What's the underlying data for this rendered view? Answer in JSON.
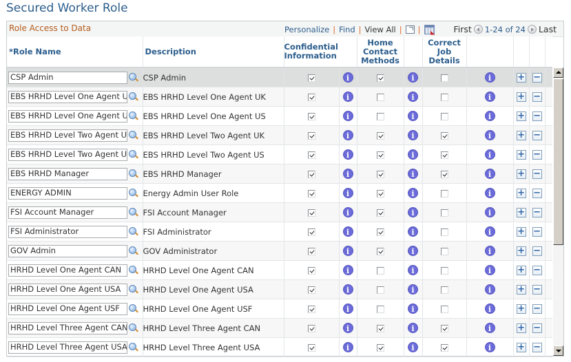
{
  "page": {
    "title": "Secured Worker Role"
  },
  "grid": {
    "title": "Role Access to Data",
    "nav": {
      "personalize": "Personalize",
      "find": "Find",
      "view_all": "View All",
      "separator": "|",
      "zoom_icon": "new-window-icon",
      "download_icon": "download-to-excel-icon",
      "first": "First",
      "range": "1-24 of 24",
      "last": "Last"
    },
    "columns": {
      "role_name": "*Role Name",
      "description": "Description",
      "confidential": "Confidential Information",
      "home_contact": "Home Contact Methods",
      "correct_job": "Correct Job Details"
    },
    "info_glyph": "i",
    "add_glyph": "+",
    "remove_glyph": "−",
    "rows": [
      {
        "role": "CSP Admin",
        "desc": "CSP Admin",
        "confidential": true,
        "home_contact": true,
        "correct_job": false
      },
      {
        "role": "EBS HRHD Level One Agent UK",
        "desc": "EBS HRHD Level One Agent UK",
        "confidential": true,
        "home_contact": false,
        "correct_job": false
      },
      {
        "role": "EBS HRHD Level One Agent US",
        "desc": "EBS HRHD Level One Agent US",
        "confidential": true,
        "home_contact": false,
        "correct_job": false
      },
      {
        "role": "EBS HRHD Level Two Agent UK",
        "desc": "EBS HRHD Level Two Agent UK",
        "confidential": true,
        "home_contact": true,
        "correct_job": true
      },
      {
        "role": "EBS HRHD Level Two Agent US",
        "desc": "EBS HRHD Level Two Agent US",
        "confidential": true,
        "home_contact": true,
        "correct_job": true
      },
      {
        "role": "EBS HRHD Manager",
        "desc": "EBS HRHD Manager",
        "confidential": true,
        "home_contact": true,
        "correct_job": true
      },
      {
        "role": "ENERGY ADMIN",
        "desc": "Energy Admin User Role",
        "confidential": true,
        "home_contact": true,
        "correct_job": false
      },
      {
        "role": "FSI Account Manager",
        "desc": "FSI Account Manager",
        "confidential": true,
        "home_contact": true,
        "correct_job": false
      },
      {
        "role": "FSI Administrator",
        "desc": "FSI Administrator",
        "confidential": true,
        "home_contact": true,
        "correct_job": false
      },
      {
        "role": "GOV Admin",
        "desc": "GOV Administrator",
        "confidential": true,
        "home_contact": true,
        "correct_job": false
      },
      {
        "role": "HRHD Level One Agent CAN",
        "desc": "HRHD Level One Agent CAN",
        "confidential": true,
        "home_contact": false,
        "correct_job": false
      },
      {
        "role": "HRHD Level One Agent USA",
        "desc": "HRHD Level One Agent USA",
        "confidential": true,
        "home_contact": false,
        "correct_job": false
      },
      {
        "role": "HRHD Level One Agent USF",
        "desc": "HRHD Level One Agent USF",
        "confidential": true,
        "home_contact": false,
        "correct_job": false
      },
      {
        "role": "HRHD Level Three Agent CAN",
        "desc": "HRHD Level Three Agent CAN",
        "confidential": true,
        "home_contact": true,
        "correct_job": true
      },
      {
        "role": "HRHD Level Three Agent USA",
        "desc": "HRHD Level Three Agent USA",
        "confidential": true,
        "home_contact": true,
        "correct_job": true
      }
    ],
    "selected_row": 0,
    "scroll_position": 0
  },
  "colors": {
    "title_blue": "#2b5d8c",
    "grid_title_orange": "#b35c1b",
    "info_purple": "#6b6bd9",
    "selected_row_bg": "#dcdfdd"
  }
}
